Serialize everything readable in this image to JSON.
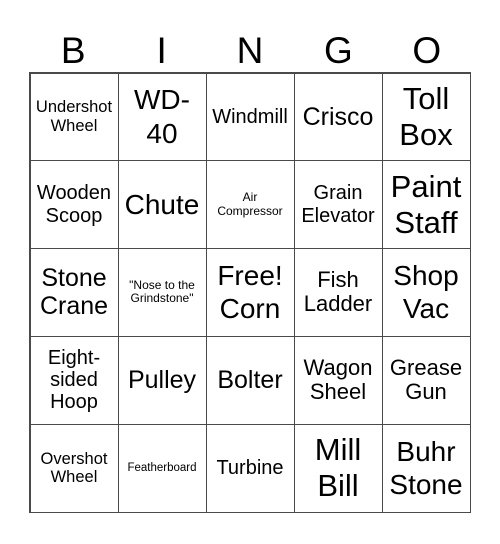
{
  "header": {
    "letters": [
      "B",
      "I",
      "N",
      "G",
      "O"
    ]
  },
  "grid": {
    "cells": [
      "Undershot Wheel",
      "WD-40",
      "Windmill",
      "Crisco",
      "Toll Box",
      "Wooden Scoop",
      "Chute",
      "Air Compressor",
      "Grain Elevator",
      "Paint Staff",
      "Stone Crane",
      "\"Nose to the Grindstone\"",
      "Free! Corn",
      "Fish Ladder",
      "Shop Vac",
      "Eight-sided Hoop",
      "Pulley",
      "Bolter",
      "Wagon Sheel",
      "Grease Gun",
      "Overshot Wheel",
      "Featherboard",
      "Turbine",
      "Mill Bill",
      "Buhr Stone"
    ]
  }
}
